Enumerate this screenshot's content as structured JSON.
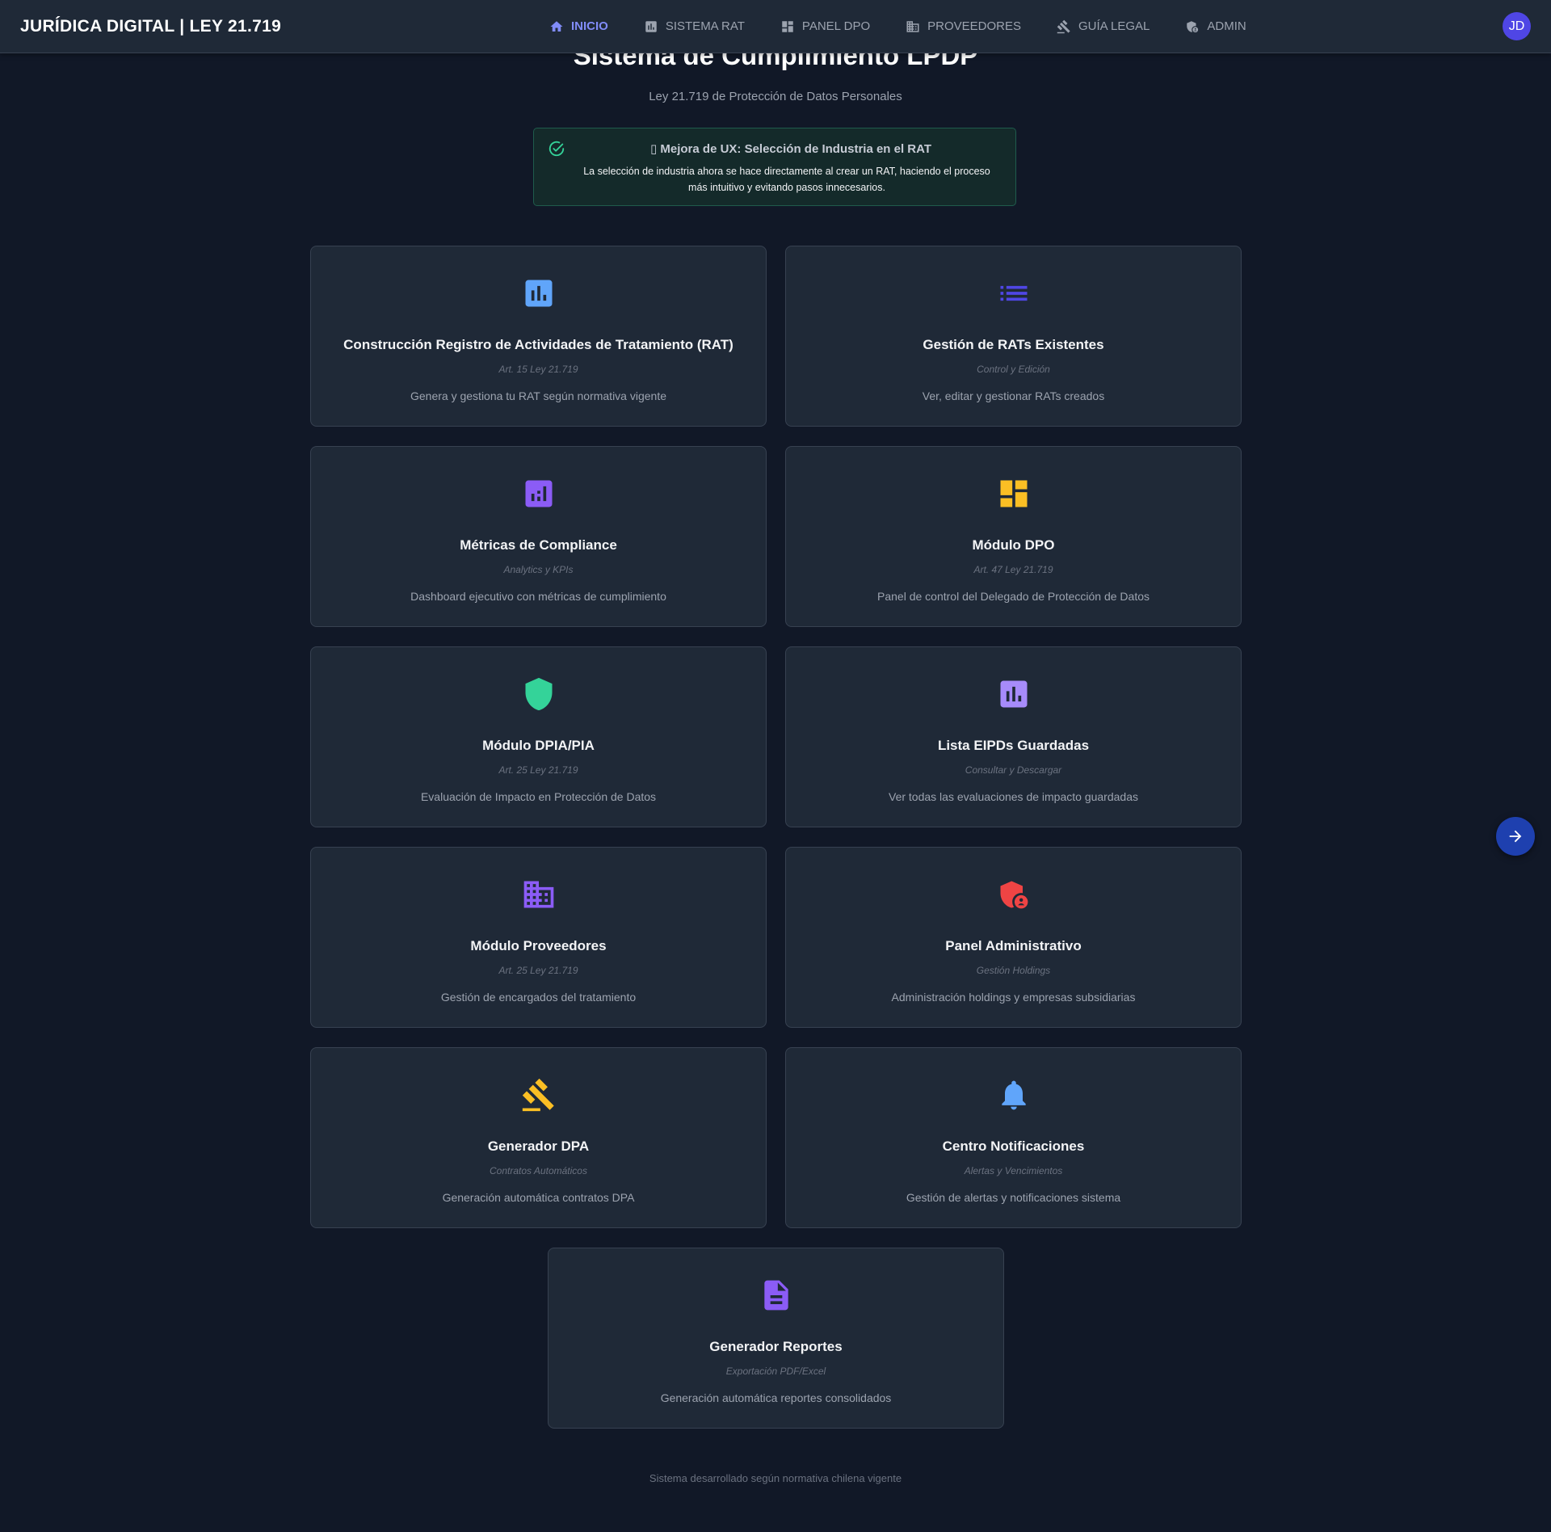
{
  "app": {
    "brand": "JURÍDICA DIGITAL | LEY 21.719"
  },
  "nav": {
    "items": [
      {
        "label": "INICIO",
        "icon": "home-icon",
        "active": true
      },
      {
        "label": "SISTEMA RAT",
        "icon": "chart-icon"
      },
      {
        "label": "PANEL DPO",
        "icon": "dashboard-icon"
      },
      {
        "label": "PROVEEDORES",
        "icon": "building-icon"
      },
      {
        "label": "GUÍA LEGAL",
        "icon": "gavel-icon"
      },
      {
        "label": "ADMIN",
        "icon": "admin-shield-icon"
      }
    ],
    "avatar_initials": "JD"
  },
  "header": {
    "title": "Sistema de Cumplimiento LPDP",
    "subtitle": "Ley 21.719 de Protección de Datos Personales"
  },
  "notice": {
    "title": "▯ Mejora de UX: Selección de Industria en el RAT",
    "text": "La selección de industria ahora se hace directamente al crear un RAT, haciendo el proceso más intuitivo y evitando pasos innecesarios."
  },
  "cards": [
    {
      "title": "Construcción Registro de Actividades de Tratamiento (RAT)",
      "subtitle": "Art. 15 Ley 21.719",
      "description": "Genera y gestiona tu RAT según normativa vigente",
      "icon": "bar-chart-icon",
      "color": "#60a5fa"
    },
    {
      "title": "Gestión de RATs Existentes",
      "subtitle": "Control y Edición",
      "description": "Ver, editar y gestionar RATs creados",
      "icon": "list-icon",
      "color": "#4f46e5"
    },
    {
      "title": "Métricas de Compliance",
      "subtitle": "Analytics y KPIs",
      "description": "Dashboard ejecutivo con métricas de cumplimiento",
      "icon": "analytics-icon",
      "color": "#8b5cf6"
    },
    {
      "title": "Módulo DPO",
      "subtitle": "Art. 47 Ley 21.719",
      "description": "Panel de control del Delegado de Protección de Datos",
      "icon": "dashboard-icon",
      "color": "#fbbf24"
    },
    {
      "title": "Módulo DPIA/PIA",
      "subtitle": "Art. 25 Ley 21.719",
      "description": "Evaluación de Impacto en Protección de Datos",
      "icon": "shield-icon",
      "color": "#34d399"
    },
    {
      "title": "Lista EIPDs Guardadas",
      "subtitle": "Consultar y Descargar",
      "description": "Ver todas las evaluaciones de impacto guardadas",
      "icon": "bar-chart-icon",
      "color": "#a78bfa"
    },
    {
      "title": "Módulo Proveedores",
      "subtitle": "Art. 25 Ley 21.719",
      "description": "Gestión de encargados del tratamiento",
      "icon": "building-icon",
      "color": "#8b5cf6"
    },
    {
      "title": "Panel Administrativo",
      "subtitle": "Gestión Holdings",
      "description": "Administración holdings y empresas subsidiarias",
      "icon": "admin-shield-icon",
      "color": "#ef4444"
    },
    {
      "title": "Generador DPA",
      "subtitle": "Contratos Automáticos",
      "description": "Generación automática contratos DPA",
      "icon": "gavel-icon",
      "color": "#fbbf24"
    },
    {
      "title": "Centro Notificaciones",
      "subtitle": "Alertas y Vencimientos",
      "description": "Gestión de alertas y notificaciones sistema",
      "icon": "bell-icon",
      "color": "#60a5fa"
    },
    {
      "title": "Generador Reportes",
      "subtitle": "Exportación PDF/Excel",
      "description": "Generación automática reportes consolidados",
      "icon": "document-icon",
      "color": "#8b5cf6"
    }
  ],
  "footer": {
    "text": "Sistema desarrollado según normativa chilena vigente"
  },
  "fab": {
    "icon": "arrow-right-icon"
  },
  "colors": {
    "background": "#111827",
    "card": "#1f2937",
    "accent": "#818cf8",
    "success": "#34d399"
  }
}
